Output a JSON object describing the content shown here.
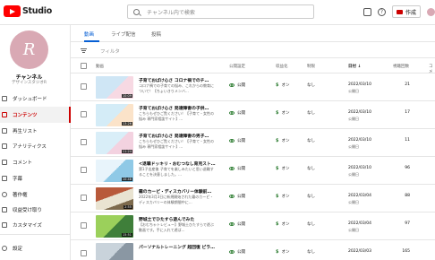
{
  "header": {
    "logo_text": "Studio",
    "search_placeholder": "チャンネル内で検索",
    "help_icon": "?",
    "create_label": "作成"
  },
  "channel": {
    "avatar_letter": "R",
    "name": "チャンネル",
    "subtitle": "デザインスタジオR"
  },
  "sidebar": {
    "items": [
      {
        "label": "ダッシュボード"
      },
      {
        "label": "コンテンツ"
      },
      {
        "label": "再生リスト"
      },
      {
        "label": "アナリティクス"
      },
      {
        "label": "コメント"
      },
      {
        "label": "字幕"
      },
      {
        "label": "著作権"
      },
      {
        "label": "収益受け取り"
      },
      {
        "label": "カスタマイズ"
      },
      {
        "label": "設定"
      }
    ]
  },
  "tabs": [
    {
      "label": "動画"
    },
    {
      "label": "ライブ配信"
    },
    {
      "label": "投稿"
    }
  ],
  "filter": {
    "label": "フィルタ"
  },
  "table": {
    "headers": {
      "video": "動画",
      "visibility": "公開設定",
      "monetization": "収益化",
      "restrictions": "制限",
      "date": "日付 ↓",
      "views": "視聴回数",
      "comments": "コメ"
    },
    "rows": [
      {
        "title": "子育ておばけ心さ コロナ禍でのチ…",
        "desc": "コロナ禍での子育ての悩み、これからの教育について！【ちょいきりメンバ…",
        "duration": "10:09",
        "visibility": "公開",
        "monetization": "オン",
        "restriction": "なし",
        "date": "2022/03/10",
        "date_status": "公開日",
        "views": "21",
        "comments": ""
      },
      {
        "title": "子育ておばけ心さ 発達障害の子供…",
        "desc": "こちらもぜひご覧ください！【子育て・女性の悩み 専門家相談サイト】…",
        "duration": "13:26",
        "visibility": "公開",
        "monetization": "オン",
        "restriction": "なし",
        "date": "2022/03/10",
        "date_status": "公開日",
        "views": "17",
        "comments": ""
      },
      {
        "title": "子育ておばけ心さ 発達障害の男子…",
        "desc": "こちらもぜひご覧ください！【子育て・女性の悩み 専門家相談サイト】…",
        "duration": "11:24",
        "visibility": "公開",
        "monetization": "オン",
        "restriction": "なし",
        "date": "2022/03/10",
        "date_status": "公開日",
        "views": "11",
        "comments": ""
      },
      {
        "title": "<退職ドッキリ・おむつなし育児スト…",
        "desc": "第1子出産後 子育てを楽しみたいと思い退職することを決意しました。…",
        "duration": "10:48",
        "visibility": "公開",
        "monetization": "オン",
        "restriction": "なし",
        "date": "2022/03/10",
        "date_status": "公開日",
        "views": "96",
        "comments": ""
      },
      {
        "title": "霧のカーピ・ディスカバリー体験前…",
        "desc": "2022年3月3日に新規開始された霧のカーピ・ディスカバリーの体験期間中に…",
        "duration": "2:55",
        "visibility": "公開",
        "monetization": "オン",
        "restriction": "なし",
        "date": "2022/03/04",
        "date_status": "公開日",
        "views": "88",
        "comments": ""
      },
      {
        "title": "野城土でひたすら遊んでみた",
        "desc": "【おむちゃトレビュー】野城土ひたすらで遊ぶ動画です。手に入れて遊ば…",
        "duration": "15:51",
        "visibility": "公開",
        "monetization": "オン",
        "restriction": "なし",
        "date": "2022/03/04",
        "date_status": "公開日",
        "views": "97",
        "comments": ""
      },
      {
        "title": "パーソナルトレーニング 超回復 ピラ…",
        "desc": "",
        "duration": "",
        "visibility": "公開",
        "monetization": "オン",
        "restriction": "なし",
        "date": "2022/03/03",
        "date_status": "",
        "views": "165",
        "comments": ""
      }
    ]
  },
  "colors": {
    "brand_red": "#ff0000",
    "active_red": "#cc0000",
    "tab_blue": "#065fd4",
    "status_green": "#2e7d32",
    "avatar_pink": "#d9a9b4"
  }
}
